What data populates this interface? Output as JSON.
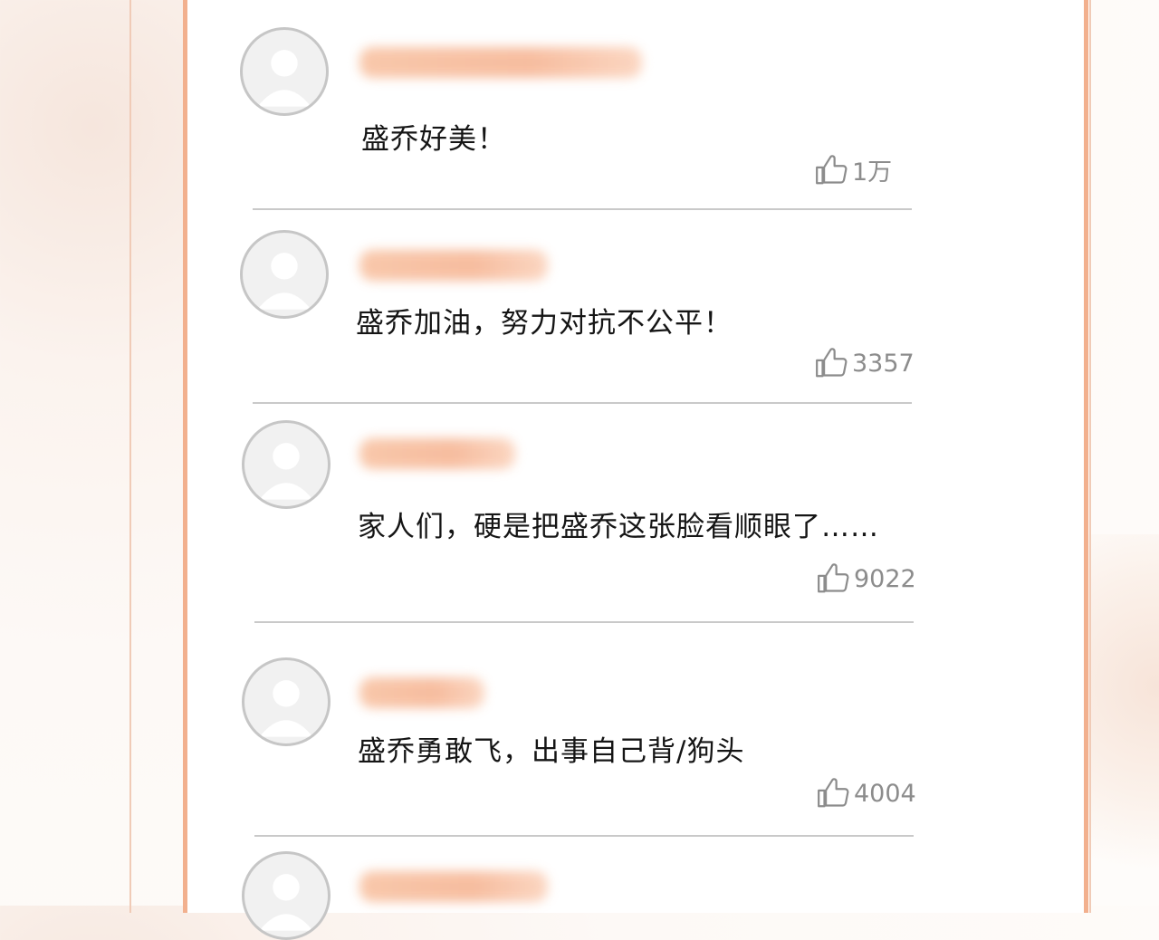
{
  "comments": [
    {
      "text": "盛乔好美！",
      "likes": "1万"
    },
    {
      "text": "盛乔加油，努力对抗不公平！",
      "likes": "3357"
    },
    {
      "text": "家人们，硬是把盛乔这张脸看顺眼了……",
      "likes": "9022"
    },
    {
      "text": "盛乔勇敢飞，出事自己背/狗头",
      "likes": "4004"
    },
    {
      "text": "",
      "likes": ""
    }
  ],
  "icons": {
    "avatar": "default-user-avatar-icon",
    "like": "thumbs-up-icon"
  },
  "colors": {
    "accent": "#f2b08e",
    "blur_name": "#f6b695",
    "text": "#151515",
    "meta": "#8c8c8c"
  }
}
